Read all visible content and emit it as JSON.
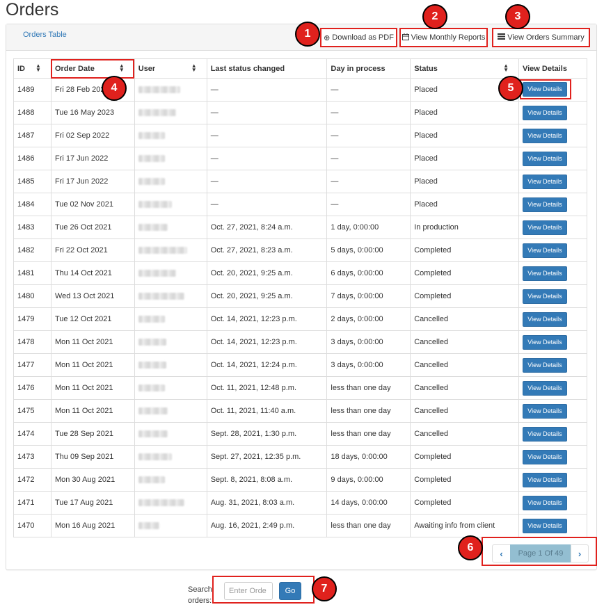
{
  "page": {
    "title": "Orders"
  },
  "panel": {
    "title": "Orders Table",
    "actions": {
      "download_pdf": "Download as PDF",
      "monthly_reports": "View Monthly Reports",
      "orders_summary": "View Orders Summary"
    }
  },
  "table": {
    "columns": [
      "ID",
      "Order Date",
      "User",
      "Last status changed",
      "Day in process",
      "Status",
      "View Details"
    ],
    "view_details_label": "View Details",
    "rows": [
      {
        "id": "1489",
        "date": "Fri 28 Feb 2025",
        "last_changed": "—",
        "days": "—",
        "status": "Placed"
      },
      {
        "id": "1488",
        "date": "Tue 16 May 2023",
        "last_changed": "—",
        "days": "—",
        "status": "Placed"
      },
      {
        "id": "1487",
        "date": "Fri 02 Sep 2022",
        "last_changed": "—",
        "days": "—",
        "status": "Placed"
      },
      {
        "id": "1486",
        "date": "Fri 17 Jun 2022",
        "last_changed": "—",
        "days": "—",
        "status": "Placed"
      },
      {
        "id": "1485",
        "date": "Fri 17 Jun 2022",
        "last_changed": "—",
        "days": "—",
        "status": "Placed"
      },
      {
        "id": "1484",
        "date": "Tue 02 Nov 2021",
        "last_changed": "—",
        "days": "—",
        "status": "Placed"
      },
      {
        "id": "1483",
        "date": "Tue 26 Oct 2021",
        "last_changed": "Oct. 27, 2021, 8:24 a.m.",
        "days": "1 day, 0:00:00",
        "status": "In production"
      },
      {
        "id": "1482",
        "date": "Fri 22 Oct 2021",
        "last_changed": "Oct. 27, 2021, 8:23 a.m.",
        "days": "5 days, 0:00:00",
        "status": "Completed"
      },
      {
        "id": "1481",
        "date": "Thu 14 Oct 2021",
        "last_changed": "Oct. 20, 2021, 9:25 a.m.",
        "days": "6 days, 0:00:00",
        "status": "Completed"
      },
      {
        "id": "1480",
        "date": "Wed 13 Oct 2021",
        "last_changed": "Oct. 20, 2021, 9:25 a.m.",
        "days": "7 days, 0:00:00",
        "status": "Completed"
      },
      {
        "id": "1479",
        "date": "Tue 12 Oct 2021",
        "last_changed": "Oct. 14, 2021, 12:23 p.m.",
        "days": "2 days, 0:00:00",
        "status": "Cancelled"
      },
      {
        "id": "1478",
        "date": "Mon 11 Oct 2021",
        "last_changed": "Oct. 14, 2021, 12:23 p.m.",
        "days": "3 days, 0:00:00",
        "status": "Cancelled"
      },
      {
        "id": "1477",
        "date": "Mon 11 Oct 2021",
        "last_changed": "Oct. 14, 2021, 12:24 p.m.",
        "days": "3 days, 0:00:00",
        "status": "Cancelled"
      },
      {
        "id": "1476",
        "date": "Mon 11 Oct 2021",
        "last_changed": "Oct. 11, 2021, 12:48 p.m.",
        "days": "less than one day",
        "status": "Cancelled"
      },
      {
        "id": "1475",
        "date": "Mon 11 Oct 2021",
        "last_changed": "Oct. 11, 2021, 11:40 a.m.",
        "days": "less than one day",
        "status": "Cancelled"
      },
      {
        "id": "1474",
        "date": "Tue 28 Sep 2021",
        "last_changed": "Sept. 28, 2021, 1:30 p.m.",
        "days": "less than one day",
        "status": "Cancelled"
      },
      {
        "id": "1473",
        "date": "Thu 09 Sep 2021",
        "last_changed": "Sept. 27, 2021, 12:35 p.m.",
        "days": "18 days, 0:00:00",
        "status": "Completed"
      },
      {
        "id": "1472",
        "date": "Mon 30 Aug 2021",
        "last_changed": "Sept. 8, 2021, 8:08 a.m.",
        "days": "9 days, 0:00:00",
        "status": "Completed"
      },
      {
        "id": "1471",
        "date": "Tue 17 Aug 2021",
        "last_changed": "Aug. 31, 2021, 8:03 a.m.",
        "days": "14 days, 0:00:00",
        "status": "Completed"
      },
      {
        "id": "1470",
        "date": "Mon 16 Aug 2021",
        "last_changed": "Aug. 16, 2021, 2:49 p.m.",
        "days": "less than one day",
        "status": "Awaiting info from client"
      }
    ]
  },
  "pagination": {
    "label": "Page 1 Of 49",
    "prev_icon": "chevron-left-icon",
    "next_icon": "chevron-right-icon"
  },
  "search": {
    "label": "Search orders:",
    "placeholder": "Enter Orde",
    "go_label": "Go"
  },
  "annotations": [
    "1",
    "2",
    "3",
    "4",
    "5",
    "6",
    "7"
  ],
  "colors": {
    "accent": "#337ab7",
    "annotation": "#e0211d"
  }
}
